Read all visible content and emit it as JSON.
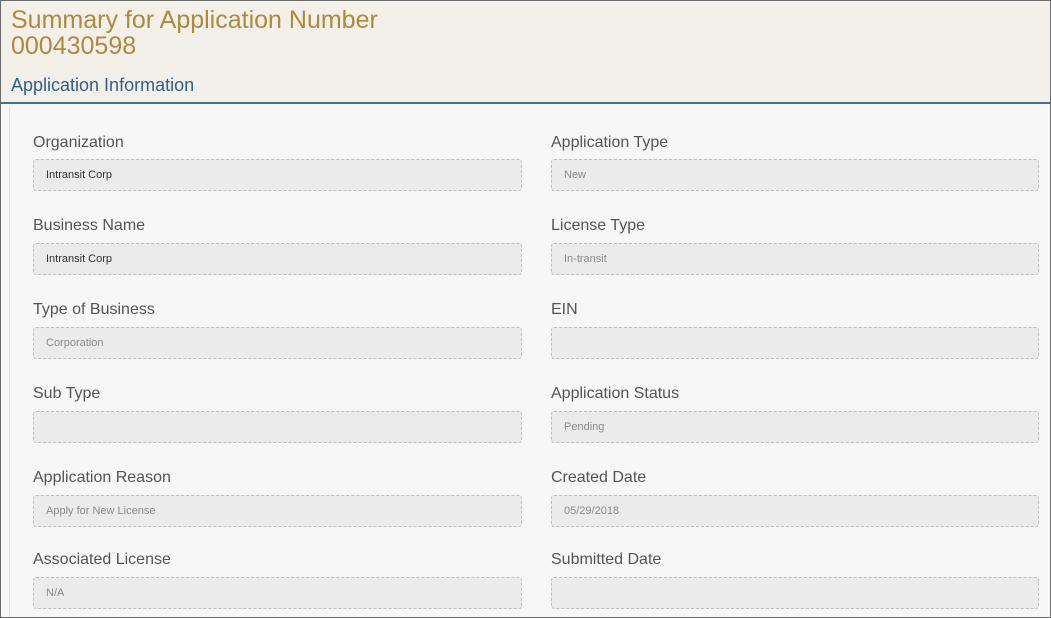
{
  "header": {
    "title_line1": "Summary for Application Number",
    "title_line2": "000430598",
    "section_title": "Application Information"
  },
  "fields": {
    "organization": {
      "label": "Organization",
      "value": "Intransit Corp"
    },
    "application_type": {
      "label": "Application Type",
      "value": "New"
    },
    "business_name": {
      "label": "Business Name",
      "value": "Intransit Corp"
    },
    "license_type": {
      "label": "License Type",
      "value": "In-transit"
    },
    "type_of_business": {
      "label": "Type of Business",
      "value": "Corporation"
    },
    "ein": {
      "label": "EIN",
      "value": ""
    },
    "sub_type": {
      "label": "Sub Type",
      "value": ""
    },
    "application_status": {
      "label": "Application Status",
      "value": "Pending"
    },
    "application_reason": {
      "label": "Application Reason",
      "value": "Apply for New License"
    },
    "created_date": {
      "label": "Created Date",
      "value": "05/29/2018"
    },
    "associated_license": {
      "label": "Associated License",
      "value": "N/A"
    },
    "submitted_date": {
      "label": "Submitted Date",
      "value": ""
    }
  },
  "colors": {
    "title": "#ad8a3e",
    "section_title": "#2f5f8f",
    "header_background": "#f3efe9",
    "header_rule": "#3f6f9c",
    "field_background": "#ebebeb"
  }
}
